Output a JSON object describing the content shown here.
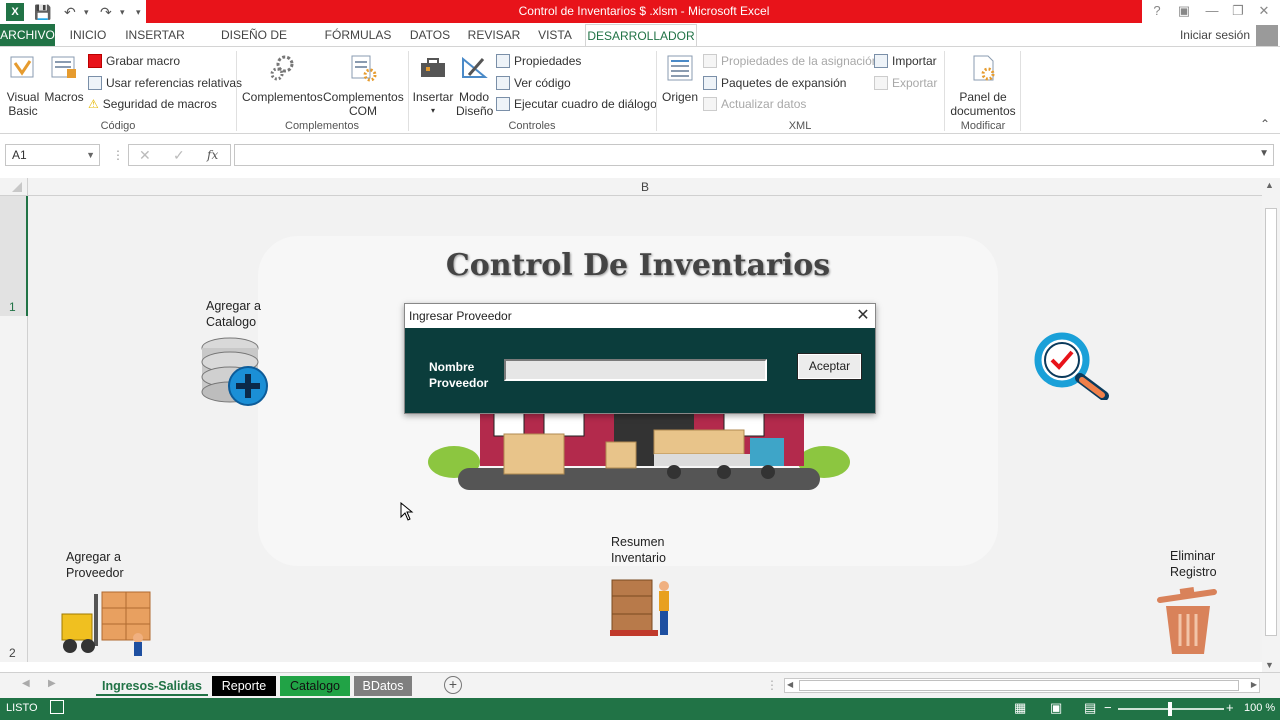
{
  "window": {
    "title": "Control de Inventarios $ .xlsm  -  Microsoft Excel",
    "signin": "Iniciar sesión"
  },
  "tabs": {
    "file": "ARCHIVO",
    "home": "INICIO",
    "insert": "INSERTAR",
    "layout": "DISEÑO DE PÁGINA",
    "formulas": "FÓRMULAS",
    "data": "DATOS",
    "review": "REVISAR",
    "view": "VISTA",
    "developer": "DESARROLLADOR"
  },
  "ribbon": {
    "codigo": {
      "label": "Código",
      "visual_basic_1": "Visual",
      "visual_basic_2": "Basic",
      "macros": "Macros",
      "record": "Grabar macro",
      "relative": "Usar referencias relativas",
      "security": "Seguridad de macros"
    },
    "complementos": {
      "label": "Complementos",
      "addins": "Complementos",
      "com_1": "Complementos",
      "com_2": "COM"
    },
    "controles": {
      "label": "Controles",
      "insert": "Insertar",
      "design_1": "Modo",
      "design_2": "Diseño",
      "properties": "Propiedades",
      "view_code": "Ver código",
      "run_dialog": "Ejecutar cuadro de diálogo"
    },
    "xml": {
      "label": "XML",
      "source": "Origen",
      "map_props": "Propiedades de la asignación",
      "packs": "Paquetes de expansión",
      "refresh": "Actualizar datos",
      "import": "Importar",
      "export": "Exportar"
    },
    "modificar": {
      "label": "Modificar",
      "panel_1": "Panel de",
      "panel_2": "documentos"
    }
  },
  "formula_bar": {
    "name_box": "A1",
    "fx": "fx",
    "value": ""
  },
  "grid": {
    "column_b": "B",
    "row_1": "1",
    "row_2": "2"
  },
  "sheet": {
    "title": "Control De Inventarios",
    "add_catalog_1": "Agregar a",
    "add_catalog_2": "Catalogo",
    "add_supplier_1": "Agregar a",
    "add_supplier_2": "Proveedor",
    "summary_1": "Resumen",
    "summary_2": "Inventario",
    "delete_1": "Eliminar",
    "delete_2": "Registro"
  },
  "dialog": {
    "title": "Ingresar Proveedor",
    "label_1": "Nombre",
    "label_2": "Proveedor",
    "input_value": "",
    "ok": "Aceptar"
  },
  "sheet_tabs": [
    {
      "label": "Ingresos-Salidas",
      "bg": "#f3f3f3",
      "color": "#217346"
    },
    {
      "label": "Reporte",
      "bg": "#000000",
      "color": "#ffffff"
    },
    {
      "label": "Catalogo",
      "bg": "#21a346",
      "color": "#111111"
    },
    {
      "label": "BDatos",
      "bg": "#7f7f7f",
      "color": "#ffffff"
    }
  ],
  "status": {
    "mode": "LISTO",
    "zoom": "100 %"
  },
  "colors": {
    "excel_green": "#217346",
    "title_red": "#e8131a",
    "dialog_body": "#0b3d3c"
  }
}
